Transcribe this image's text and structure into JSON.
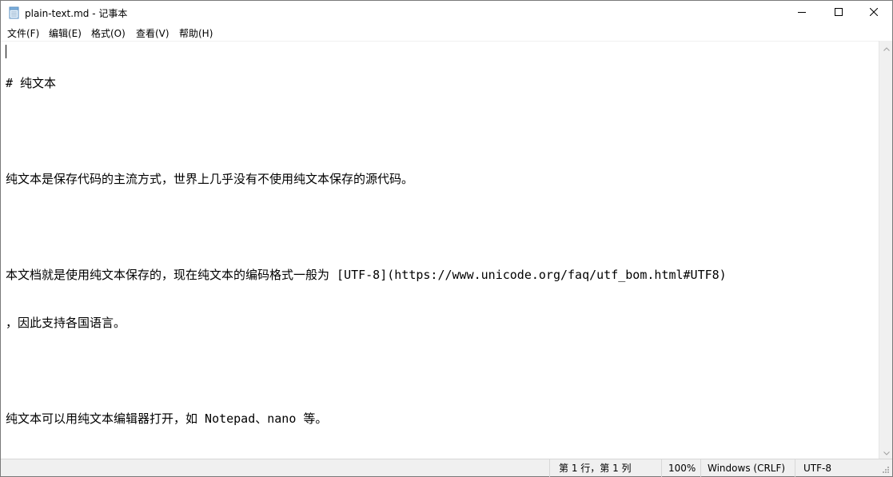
{
  "window": {
    "title": "plain-text.md - 记事本",
    "icons": {
      "app": "notepad-icon",
      "minimize": "minimize-icon",
      "maximize": "maximize-icon",
      "close": "close-icon"
    }
  },
  "menu": {
    "items": [
      {
        "label": "文件(F)"
      },
      {
        "label": "编辑(E)"
      },
      {
        "label": "格式(O)"
      },
      {
        "label": "查看(V)"
      },
      {
        "label": "帮助(H)"
      }
    ]
  },
  "editor": {
    "lines": [
      "# 纯文本",
      "",
      "纯文本是保存代码的主流方式，世界上几乎没有不使用纯文本保存的源代码。",
      "",
      "本文档就是使用纯文本保存的，现在纯文本的编码格式一般为 [UTF-8](https://www.unicode.org/faq/utf_bom.html#UTF8)",
      "，因此支持各国语言。",
      "",
      "纯文本可以用纯文本编辑器打开，如 Notepad、nano 等。"
    ]
  },
  "status": {
    "position": "第 1 行，第 1 列",
    "zoom": "100%",
    "line_ending": "Windows (CRLF)",
    "encoding": "UTF-8"
  },
  "scrollbar": {
    "icons": {
      "up": "chevron-up-icon",
      "down": "chevron-down-icon"
    }
  }
}
